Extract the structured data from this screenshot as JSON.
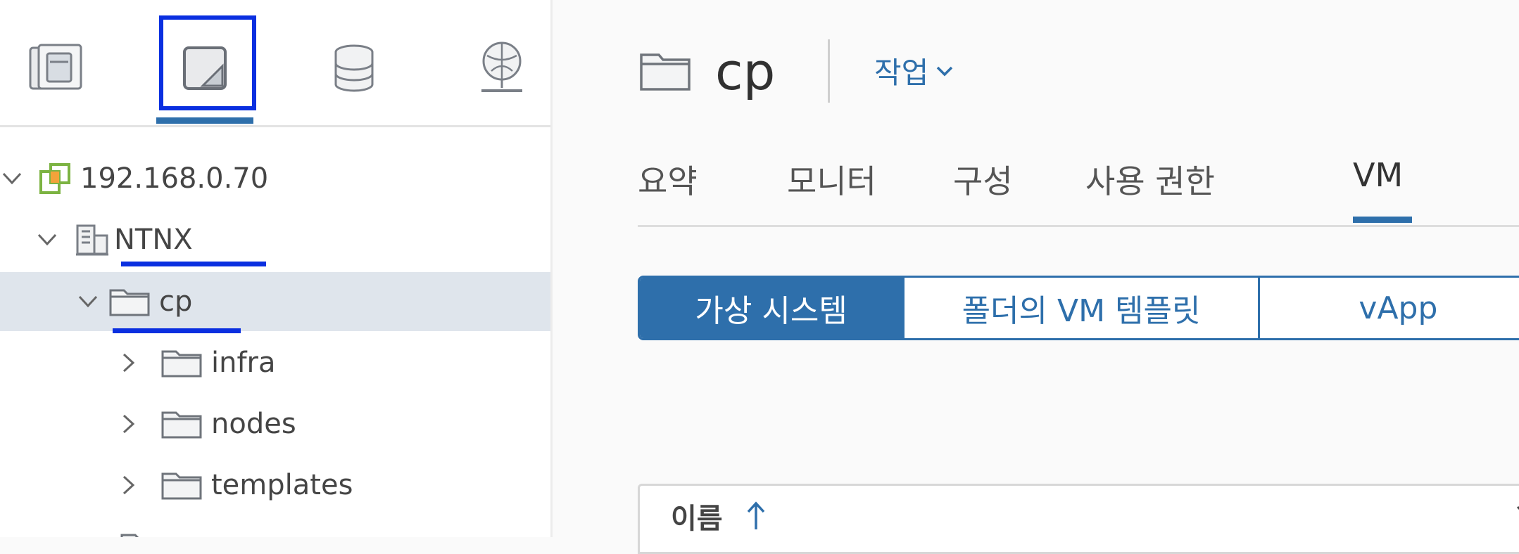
{
  "nav": {
    "tabs": [
      {
        "name": "hosts-and-clusters",
        "icon": "hosts-clusters-icon"
      },
      {
        "name": "vms-and-templates",
        "icon": "vms-templates-icon",
        "active": true
      },
      {
        "name": "storage",
        "icon": "storage-icon"
      },
      {
        "name": "networking",
        "icon": "network-icon"
      }
    ],
    "tree": [
      {
        "label": "192.168.0.70",
        "icon": "vcenter-icon",
        "expanded": true
      },
      {
        "label": "NTNX",
        "icon": "datacenter-icon",
        "expanded": true
      },
      {
        "label": "cp",
        "icon": "folder-icon",
        "expanded": true,
        "selected": true
      },
      {
        "label": "infra",
        "icon": "folder-icon",
        "expanded": false
      },
      {
        "label": "nodes",
        "icon": "folder-icon",
        "expanded": false
      },
      {
        "label": "templates",
        "icon": "folder-icon",
        "expanded": false
      }
    ]
  },
  "main": {
    "title": "cp",
    "actions_label": "작업",
    "tabs": [
      {
        "label": "요약"
      },
      {
        "label": "모니터"
      },
      {
        "label": "구성"
      },
      {
        "label": "사용 권한"
      },
      {
        "label": "VM",
        "active": true
      }
    ],
    "segments": [
      {
        "label": "가상 시스템",
        "active": true
      },
      {
        "label": "폴더의 VM 템플릿"
      },
      {
        "label": "vApp"
      }
    ],
    "grid": {
      "name_column": "이름"
    }
  },
  "colors": {
    "accent": "#2e6fab",
    "annotation": "#0a2fe0",
    "selected_row": "#dfe5ec",
    "vcenter_green": "#7cb342",
    "vcenter_orange": "#f2a33a"
  }
}
